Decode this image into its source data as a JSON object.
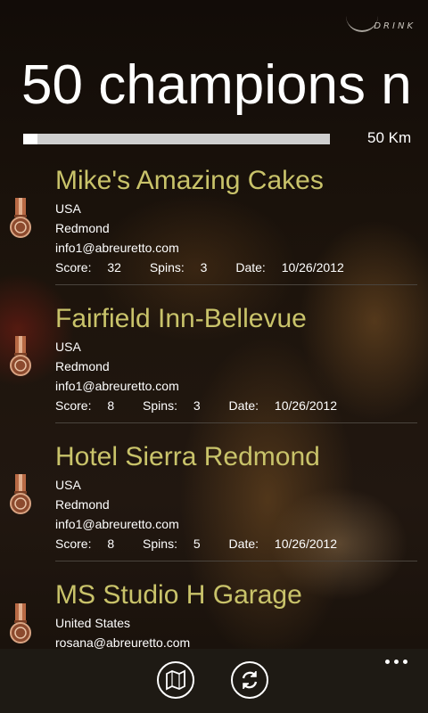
{
  "brand": {
    "logo_text": "DRINK"
  },
  "header": {
    "title": "50 champions n"
  },
  "range": {
    "value_label": "50 Km",
    "fraction": 0.03
  },
  "labels": {
    "score": "Score:",
    "spins": "Spins:",
    "date": "Date:"
  },
  "champions": [
    {
      "name": "Mike's Amazing Cakes",
      "country": "USA",
      "city": "Redmond",
      "email": "info1@abreuretto.com",
      "score": "32",
      "spins": "3",
      "date": "10/26/2012"
    },
    {
      "name": "Fairfield Inn-Bellevue",
      "country": "USA",
      "city": "Redmond",
      "email": "info1@abreuretto.com",
      "score": "8",
      "spins": "3",
      "date": "10/26/2012"
    },
    {
      "name": "Hotel Sierra Redmond",
      "country": "USA",
      "city": "Redmond",
      "email": "info1@abreuretto.com",
      "score": "8",
      "spins": "5",
      "date": "10/26/2012"
    },
    {
      "name": "MS Studio H Garage",
      "country": "United States",
      "city": "",
      "email": "rosana@abreuretto.com",
      "score": "",
      "spins": "",
      "date": ""
    }
  ],
  "app_bar": {
    "buttons": [
      {
        "icon": "map-icon"
      },
      {
        "icon": "refresh-icon"
      }
    ],
    "more_icon": "more-dots-icon"
  },
  "colors": {
    "accent": "#c9c36a",
    "medal_ribbon": "#b86a45",
    "app_bar": "#1e1a14"
  }
}
